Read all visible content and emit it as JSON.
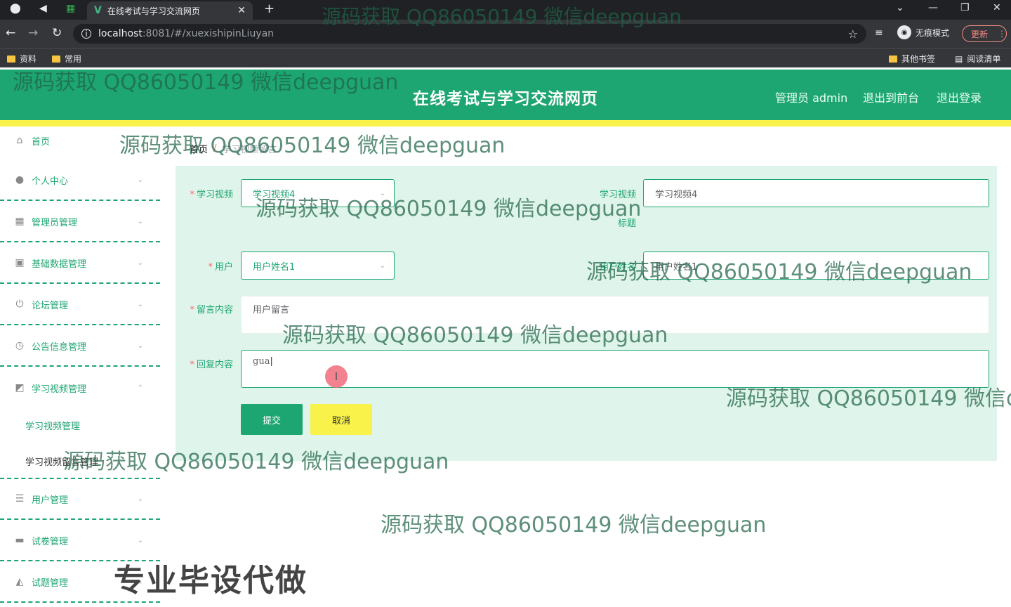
{
  "browser": {
    "tab_title": "在线考试与学习交流网页",
    "url_host": "localhost",
    "url_path": ":8081/#/xuexishipinLiuyan",
    "incognito_label": "无痕模式",
    "update_label": "更新",
    "bookmarks": [
      "资料",
      "常用"
    ],
    "bookmarks_right": [
      "其他书签",
      "阅读清单"
    ]
  },
  "header": {
    "title": "在线考试与学习交流网页",
    "links": [
      "管理员 admin",
      "退出到前台",
      "退出登录"
    ]
  },
  "sidebar": {
    "items": [
      {
        "label": "首页",
        "icon": "home-icon"
      },
      {
        "label": "个人中心",
        "icon": "user-icon"
      },
      {
        "label": "管理员管理",
        "icon": "grid-icon"
      },
      {
        "label": "基础数据管理",
        "icon": "clipboard-icon"
      },
      {
        "label": "论坛管理",
        "icon": "power-icon"
      },
      {
        "label": "公告信息管理",
        "icon": "clock-icon"
      },
      {
        "label": "学习视频管理",
        "icon": "chart-icon"
      },
      {
        "label": "用户管理",
        "icon": "list-icon"
      },
      {
        "label": "试卷管理",
        "icon": "chat-icon"
      },
      {
        "label": "试题管理",
        "icon": "thumb-icon"
      }
    ],
    "subitems": [
      "学习视频管理",
      "学习视频留言管理"
    ]
  },
  "breadcrumb": {
    "home": "首页",
    "separator": "/",
    "current": "学习视频留言"
  },
  "form": {
    "video_label": "学习视频",
    "video_value": "学习视频4",
    "video_title_label": "学习视频",
    "video_title_label_2": "标题",
    "video_title_value": "学习视频4",
    "user_label": "用户",
    "user_value": "用户姓名1",
    "user_name_label": "用户姓名",
    "user_name_value": "用户姓名1",
    "message_label": "留言内容",
    "message_value": "用户留言",
    "reply_label": "回复内容",
    "reply_value": "gua",
    "submit_label": "提交",
    "cancel_label": "取消"
  },
  "watermark": {
    "text": "源码获取 QQ86050149 微信deepguan",
    "slogan": "专业毕设代做"
  },
  "colors": {
    "primary": "#1ea672",
    "accent_yellow": "#f8f24a",
    "panel_bg": "#dff4ea",
    "required": "#f56c6c"
  }
}
